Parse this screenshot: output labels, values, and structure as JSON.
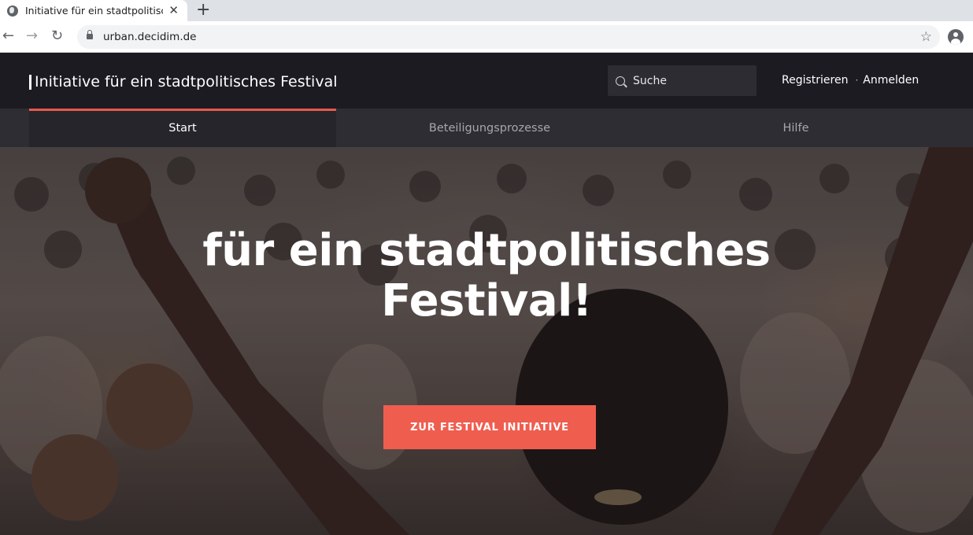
{
  "browser": {
    "tab_title": "Initiative für ein stadtpolitische",
    "url": "urban.decidim.de",
    "icons": {
      "favicon": "globe-icon",
      "close": "close-icon",
      "new_tab": "plus-icon",
      "back": "arrow-left-icon",
      "forward": "arrow-right-icon",
      "reload": "reload-icon",
      "lock": "lock-icon",
      "bookmark": "star-icon",
      "profile": "account-icon"
    }
  },
  "header": {
    "site_title": "Initiative für ein stadtpolitisches Festival",
    "search_placeholder": "Suche",
    "register_label": "Registrieren",
    "login_label": "Anmelden"
  },
  "nav": {
    "items": [
      {
        "label": "Start",
        "active": true
      },
      {
        "label": "Beteiligungsprozesse",
        "active": false
      },
      {
        "label": "Hilfe",
        "active": false
      }
    ]
  },
  "hero": {
    "title_line1": "für ein stadtpolitisches",
    "title_line2": "Festival!",
    "cta_label": "ZUR FESTIVAL INITIATIVE"
  },
  "colors": {
    "header_bg": "#1c1b22",
    "nav_bg": "#2e2d33",
    "accent": "#ef5d4f"
  }
}
